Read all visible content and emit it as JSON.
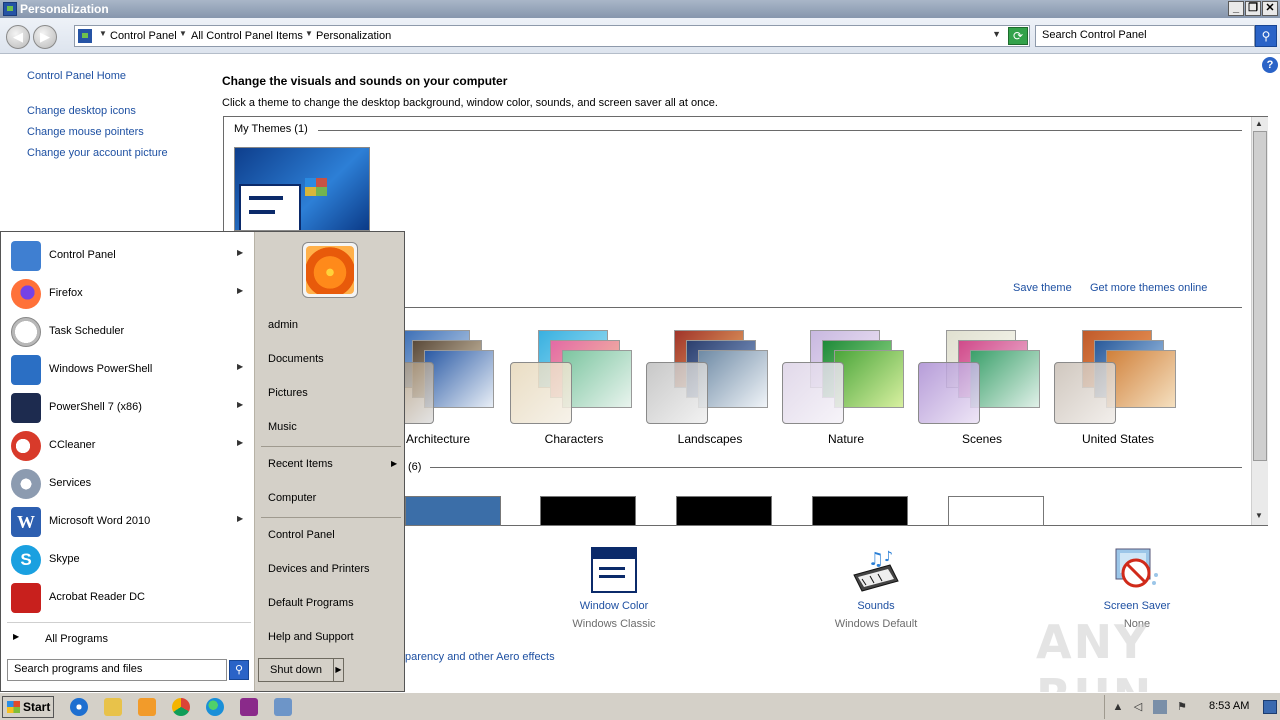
{
  "window": {
    "title": "Personalization",
    "minimize": "_",
    "restore": "❐",
    "close": "✕"
  },
  "addressbar": {
    "crumbs": [
      "Control Panel",
      "All Control Panel Items",
      "Personalization"
    ],
    "search_placeholder": "Search Control Panel"
  },
  "left_nav": {
    "home": "Control Panel Home",
    "links": [
      "Change desktop icons",
      "Change mouse pointers",
      "Change your account picture"
    ]
  },
  "main": {
    "heading": "Change the visuals and sounds on your computer",
    "subheading": "Click a theme to change the desktop background, window color, sounds, and screen saver all at once.",
    "my_themes_title": "My Themes (1)",
    "save_theme": "Save theme",
    "get_more": "Get more themes online",
    "aero_themes": [
      "Architecture",
      "Characters",
      "Landscapes",
      "Nature",
      "Scenes",
      "United States"
    ],
    "hc_title_suffix": "(6)",
    "aero_link": "parency and other Aero effects"
  },
  "bottom": {
    "window_color": {
      "label": "Window Color",
      "sub": "Windows Classic"
    },
    "sounds": {
      "label": "Sounds",
      "sub": "Windows Default"
    },
    "screen_saver": {
      "label": "Screen Saver",
      "sub": "None"
    }
  },
  "start_menu": {
    "programs": [
      {
        "label": "Control Panel",
        "icon": "control-panel-icon",
        "color": "#3f7fd1",
        "arrow": true
      },
      {
        "label": "Firefox",
        "icon": "firefox-icon",
        "color": "#ff7139",
        "arrow": true
      },
      {
        "label": "Task Scheduler",
        "icon": "clock-icon",
        "color": "#c9c9c9",
        "arrow": false
      },
      {
        "label": "Windows PowerShell",
        "icon": "powershell-icon",
        "color": "#2b6fc4",
        "arrow": true
      },
      {
        "label": "PowerShell 7 (x86)",
        "icon": "powershell7-icon",
        "color": "#1d2b4f",
        "arrow": true
      },
      {
        "label": "CCleaner",
        "icon": "ccleaner-icon",
        "color": "#d83a2a",
        "arrow": true
      },
      {
        "label": "Services",
        "icon": "gears-icon",
        "color": "#8c9bb0",
        "arrow": false
      },
      {
        "label": "Microsoft Word 2010",
        "icon": "word-icon",
        "color": "#2d5fb0",
        "arrow": true
      },
      {
        "label": "Skype",
        "icon": "skype-icon",
        "color": "#1aa0e0",
        "arrow": false
      },
      {
        "label": "Acrobat Reader DC",
        "icon": "acrobat-icon",
        "color": "#c8201d",
        "arrow": false
      }
    ],
    "all_programs": "All Programs",
    "search_placeholder": "Search programs and files",
    "right_links": [
      "admin",
      "Documents",
      "Pictures",
      "Music",
      "Recent Items",
      "Computer",
      "Control Panel",
      "Devices and Printers",
      "Default Programs",
      "Help and Support"
    ],
    "shutdown": "Shut down"
  },
  "taskbar": {
    "start": "Start",
    "clock": "8:53 AM"
  },
  "watermark": "ANY RUN"
}
